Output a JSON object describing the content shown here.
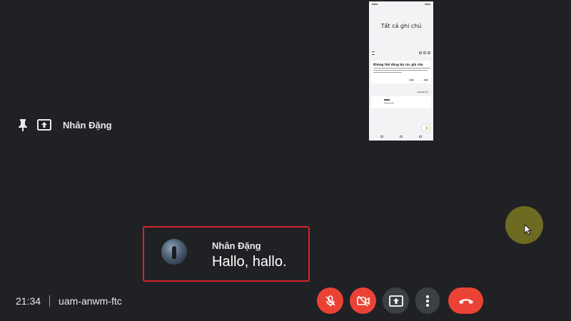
{
  "presenter": {
    "name": "Nhân Đặng",
    "pin_icon": "pin-icon",
    "present_icon": "present-to-all-icon"
  },
  "shared_screen": {
    "title": "Tất cả ghi chú",
    "card_title": "Không thể đồng bộ các ghi chú"
  },
  "caption": {
    "speaker": "Nhân Đặng",
    "text": "Hallo, hallo."
  },
  "meeting": {
    "time": "21:34",
    "code": "uam-anwm-ftc"
  },
  "controls": [
    {
      "name": "mic-off-button",
      "icon": "mic-off-icon",
      "color": "#ea4335"
    },
    {
      "name": "camera-off-button",
      "icon": "videocam-off-icon",
      "color": "#ea4335"
    },
    {
      "name": "present-now-button",
      "icon": "present-to-all-icon",
      "color": "#3c4043"
    },
    {
      "name": "more-options-button",
      "icon": "more-vert-icon",
      "color": "#3c4043"
    },
    {
      "name": "leave-call-button",
      "icon": "call-end-icon",
      "color": "#ea4335"
    }
  ],
  "colors": {
    "background": "#202124",
    "danger": "#ea4335",
    "control": "#3c4043",
    "highlight": "#d4242a",
    "cursor_halo": "#6d6a21"
  }
}
